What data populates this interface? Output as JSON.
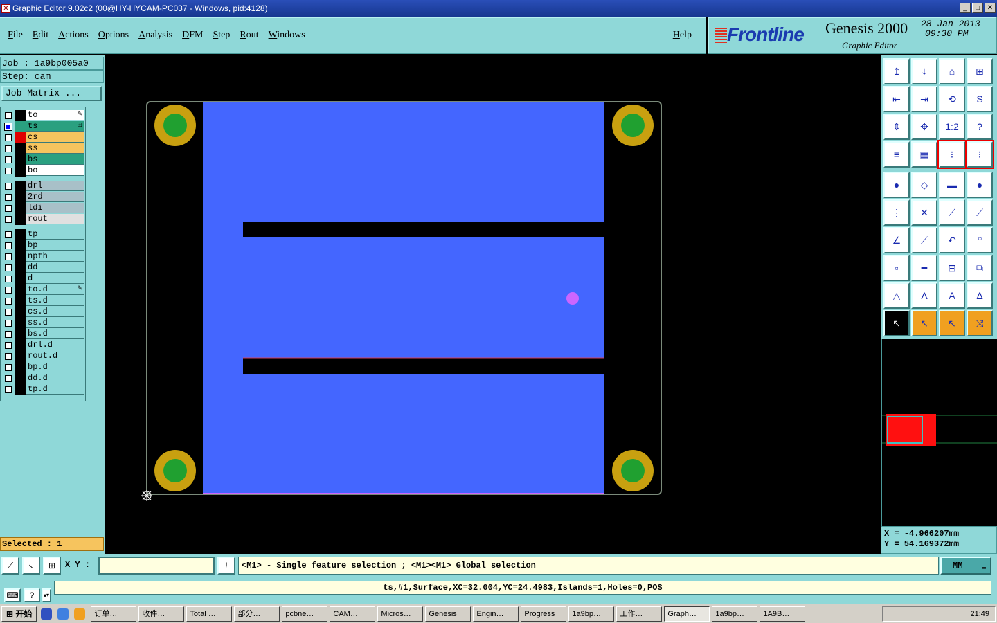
{
  "window": {
    "title": "Graphic Editor 9.02c2 (00@HY-HYCAM-PC037 - Windows, pid:4128)",
    "controls": [
      "_",
      "□",
      "✕"
    ]
  },
  "menu": [
    "File",
    "Edit",
    "Actions",
    "Options",
    "Analysis",
    "DFM",
    "Step",
    "Rout",
    "Windows"
  ],
  "help_label": "Help",
  "brand": {
    "logo": "Frontline",
    "product": "Genesis 2000",
    "subtitle": "Graphic Editor",
    "date": "28 Jan 2013",
    "time": "09:30 PM"
  },
  "job": {
    "job_line": "Job : 1a9bp005a0",
    "step_line": "Step: cam",
    "matrix_button": "Job Matrix ..."
  },
  "layers": [
    {
      "name": "to",
      "bg": "#ffffff",
      "swatch": "#000000",
      "checked": false,
      "mark": "✎"
    },
    {
      "name": "ts",
      "bg": "#2aa080",
      "swatch": "#2aa080",
      "checked": true,
      "mark": "⊞"
    },
    {
      "name": "cs",
      "bg": "#f6c45e",
      "swatch": "#e00000",
      "checked": false,
      "mark": ""
    },
    {
      "name": "ss",
      "bg": "#f6c45e",
      "swatch": "#000000",
      "checked": false,
      "mark": ""
    },
    {
      "name": "bs",
      "bg": "#2aa080",
      "swatch": "#000000",
      "checked": false,
      "mark": ""
    },
    {
      "name": "bo",
      "bg": "#ffffff",
      "swatch": "#000000",
      "checked": false,
      "mark": ""
    },
    {
      "name": "drl",
      "bg": "#a8c0c8",
      "swatch": "#000000",
      "checked": false,
      "mark": ""
    },
    {
      "name": "2rd",
      "bg": "#a8c0c8",
      "swatch": "#000000",
      "checked": false,
      "mark": ""
    },
    {
      "name": "ldi",
      "bg": "#a8c0c8",
      "swatch": "#000000",
      "checked": false,
      "mark": ""
    },
    {
      "name": "rout",
      "bg": "#e0e0e0",
      "swatch": "#000000",
      "checked": false,
      "mark": ""
    },
    {
      "name": "tp",
      "bg": "#8fd8d8",
      "swatch": "#000000",
      "checked": false,
      "mark": ""
    },
    {
      "name": "bp",
      "bg": "#8fd8d8",
      "swatch": "#000000",
      "checked": false,
      "mark": ""
    },
    {
      "name": "npth",
      "bg": "#8fd8d8",
      "swatch": "#000000",
      "checked": false,
      "mark": ""
    },
    {
      "name": "dd",
      "bg": "#8fd8d8",
      "swatch": "#000000",
      "checked": false,
      "mark": ""
    },
    {
      "name": "d",
      "bg": "#8fd8d8",
      "swatch": "#000000",
      "checked": false,
      "mark": ""
    },
    {
      "name": "to.d",
      "bg": "#8fd8d8",
      "swatch": "#000000",
      "checked": false,
      "mark": "✎"
    },
    {
      "name": "ts.d",
      "bg": "#8fd8d8",
      "swatch": "#000000",
      "checked": false,
      "mark": ""
    },
    {
      "name": "cs.d",
      "bg": "#8fd8d8",
      "swatch": "#000000",
      "checked": false,
      "mark": ""
    },
    {
      "name": "ss.d",
      "bg": "#8fd8d8",
      "swatch": "#000000",
      "checked": false,
      "mark": ""
    },
    {
      "name": "bs.d",
      "bg": "#8fd8d8",
      "swatch": "#000000",
      "checked": false,
      "mark": ""
    },
    {
      "name": "drl.d",
      "bg": "#8fd8d8",
      "swatch": "#000000",
      "checked": false,
      "mark": ""
    },
    {
      "name": "rout.d",
      "bg": "#8fd8d8",
      "swatch": "#000000",
      "checked": false,
      "mark": ""
    },
    {
      "name": "bp.d",
      "bg": "#8fd8d8",
      "swatch": "#000000",
      "checked": false,
      "mark": ""
    },
    {
      "name": "dd.d",
      "bg": "#8fd8d8",
      "swatch": "#000000",
      "checked": false,
      "mark": ""
    },
    {
      "name": "tp.d",
      "bg": "#8fd8d8",
      "swatch": "#000000",
      "checked": false,
      "mark": ""
    }
  ],
  "selected_label": "Selected : 1",
  "tools": [
    "↥",
    "⤓",
    "⌂",
    "⊞",
    "⇤",
    "⇥",
    "⟲",
    "S",
    "⇕",
    "✥",
    "1:2",
    "?",
    "≡",
    "▦",
    "⁝",
    "⁝",
    "●",
    "◇",
    "▬",
    "●",
    "⋮",
    "✕",
    "⟋",
    "⟋",
    "∠",
    "⟋",
    "↶",
    "⫯",
    "▫",
    "━",
    "⊟",
    "⧉",
    "△",
    "Λ",
    "A",
    "∆",
    "↖",
    "↖",
    "↖",
    "⤨"
  ],
  "coords": {
    "x": "X  =  -4.966207mm",
    "y": "Y  =  54.169372mm"
  },
  "command": {
    "xy_label": "X Y :",
    "xy_value": "",
    "warn": "!",
    "prompt": "<M1> - Single feature selection ; <M1><M1> Global selection",
    "units": "MM"
  },
  "status_line": "ts,#1,Surface,XC=32.004,YC=24.4983,Islands=1,Holes=0,POS",
  "taskbar": {
    "start": "开始",
    "tasks": [
      "订单…",
      "收件…",
      "Total …",
      "部分…",
      "pcbne…",
      "CAM…",
      "Micros…",
      "Genesis",
      "Engin…",
      "Progress",
      "1a9bp…",
      "工作…",
      "Graph…",
      "1a9bp…",
      "1A9B…"
    ],
    "active_index": 12,
    "clock": "21:49"
  },
  "colors": {
    "panel": "#8fd8d8",
    "copper": "#4466ff",
    "pad_ring": "#c8a010",
    "pad_core": "#20a030",
    "highlight": "#cc66ff"
  }
}
